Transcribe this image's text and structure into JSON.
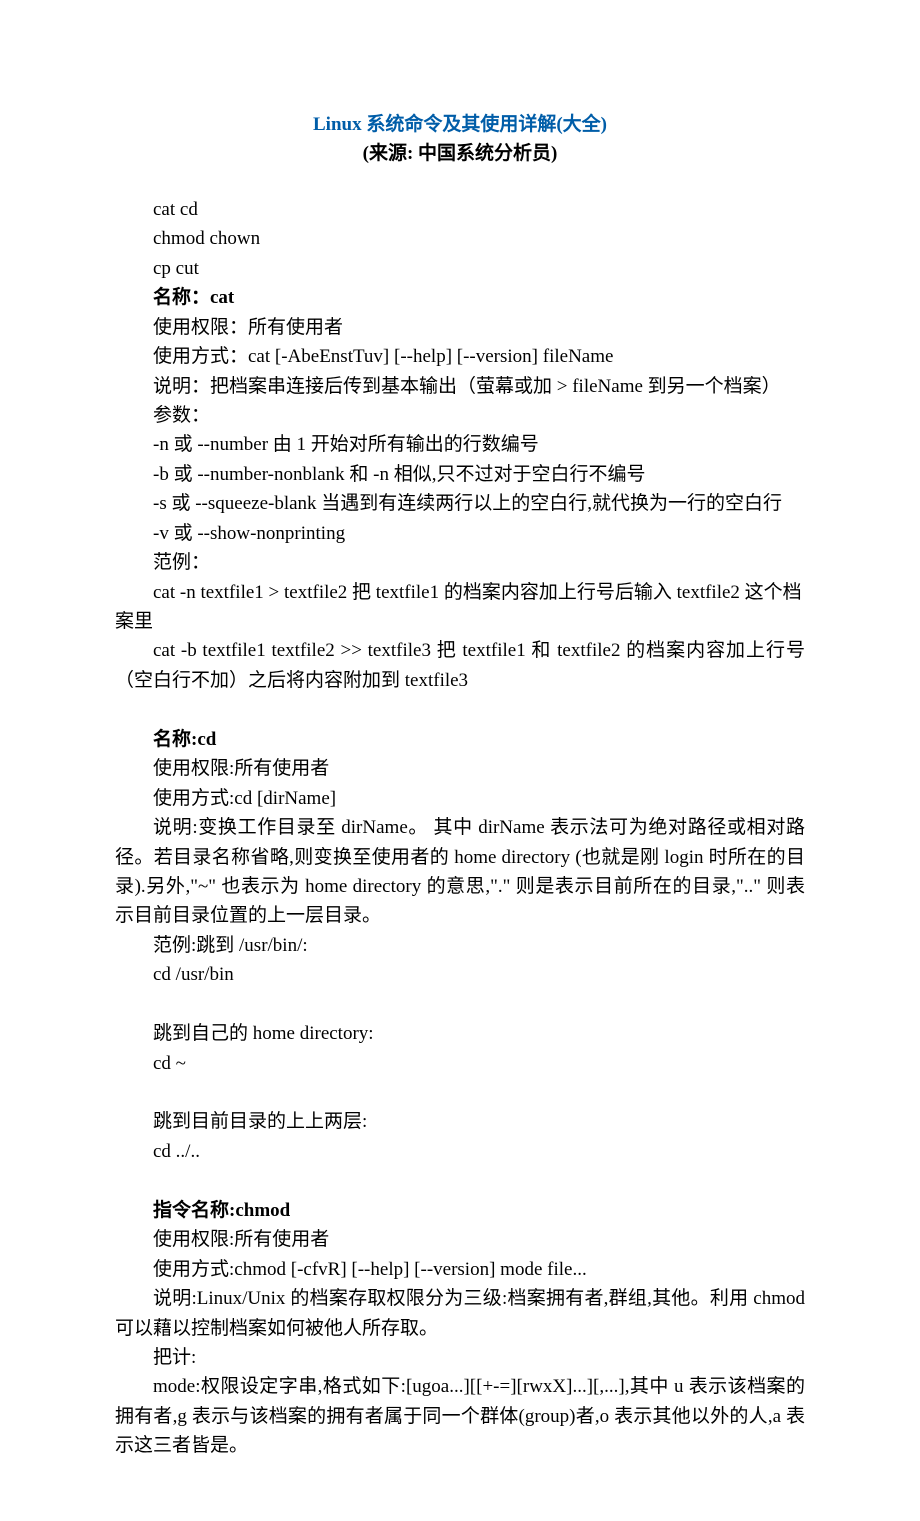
{
  "title": {
    "main": "Linux 系统命令及其使用详解(大全)",
    "sub": "(来源: 中国系统分析员)"
  },
  "intro": {
    "l1": "cat cd",
    "l2": "chmod chown",
    "l3": "cp cut"
  },
  "cat": {
    "heading": "名称：cat",
    "perm": "使用权限：所有使用者",
    "usage": "使用方式：cat [-AbeEnstTuv] [--help] [--version] fileName",
    "desc": "说明：把档案串连接后传到基本输出（萤幕或加 > fileName 到另一个档案）",
    "params_label": "参数：",
    "p1": "-n 或 --number 由 1 开始对所有输出的行数编号",
    "p2": "-b 或 --number-nonblank 和 -n 相似,只不过对于空白行不编号",
    "p3": "-s 或 --squeeze-blank 当遇到有连续两行以上的空白行,就代换为一行的空白行",
    "p4": "-v 或 --show-nonprinting",
    "ex_label": "范例：",
    "ex1": "cat -n textfile1 > textfile2 把 textfile1 的档案内容加上行号后输入 textfile2 这个档案里",
    "ex2": "cat -b textfile1 textfile2 >> textfile3 把 textfile1 和 textfile2 的档案内容加上行号（空白行不加）之后将内容附加到 textfile3"
  },
  "cd": {
    "heading": "名称:cd",
    "perm": "使用权限:所有使用者",
    "usage": "使用方式:cd [dirName]",
    "desc": "说明:变换工作目录至 dirName。 其中 dirName 表示法可为绝对路径或相对路径。若目录名称省略,则变换至使用者的 home directory (也就是刚 login 时所在的目录).另外,\"~\" 也表示为 home directory 的意思,\".\" 则是表示目前所在的目录,\"..\" 则表示目前目录位置的上一层目录。",
    "ex_label": "范例:跳到 /usr/bin/:",
    "ex1": "cd /usr/bin",
    "ex2_label": "跳到自己的 home directory:",
    "ex2": "cd ~",
    "ex3_label": "跳到目前目录的上上两层:",
    "ex3": "cd ../.."
  },
  "chmod": {
    "heading": "指令名称:chmod",
    "perm": "使用权限:所有使用者",
    "usage": "使用方式:chmod [-cfvR] [--help] [--version] mode file...",
    "desc": "说明:Linux/Unix 的档案存取权限分为三级:档案拥有者,群组,其他。利用 chmod 可以藉以控制档案如何被他人所存取。",
    "params_label": "把计:",
    "p1": "mode:权限设定字串,格式如下:[ugoa...][[+-=][rwxX]...][,...],其中 u 表示该档案的拥有者,g 表示与该档案的拥有者属于同一个群体(group)者,o 表示其他以外的人,a 表示这三者皆是。"
  }
}
